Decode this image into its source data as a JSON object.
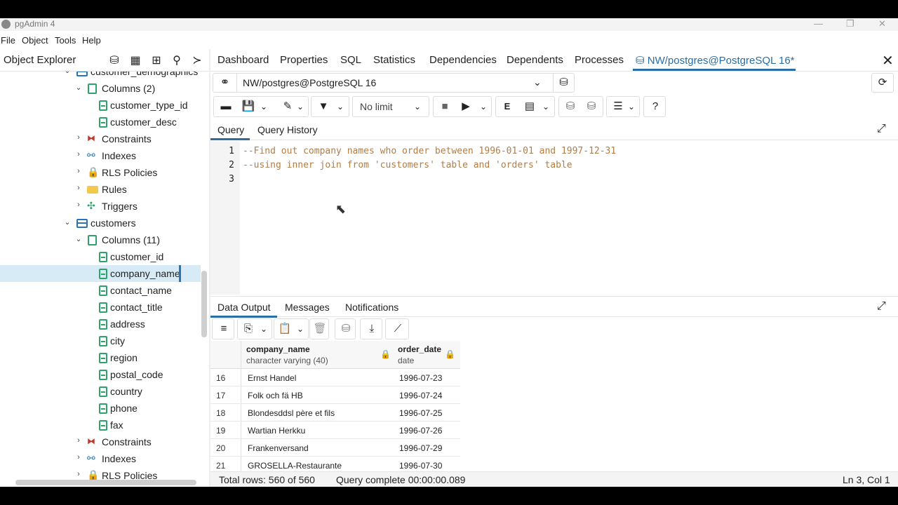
{
  "window": {
    "title": "pgAdmin 4",
    "minimize": "—",
    "maximize": "❐",
    "close": "✕"
  },
  "menu": [
    "File",
    "Object",
    "Tools",
    "Help"
  ],
  "object_explorer": {
    "title": "Object Explorer",
    "tree": [
      {
        "label": "customer_demographics",
        "twisty": "⌄",
        "icon": "table"
      },
      {
        "label": "Columns (2)",
        "twisty": "⌄",
        "icon": "columns"
      },
      {
        "label": "customer_type_id",
        "icon": "column"
      },
      {
        "label": "customer_desc",
        "icon": "column"
      },
      {
        "label": "Constraints",
        "twisty": "›",
        "icon": "constraints"
      },
      {
        "label": "Indexes",
        "twisty": "›",
        "icon": "indexes"
      },
      {
        "label": "RLS Policies",
        "twisty": "›",
        "icon": "rls"
      },
      {
        "label": "Rules",
        "twisty": "›",
        "icon": "rules"
      },
      {
        "label": "Triggers",
        "twisty": "›",
        "icon": "triggers"
      },
      {
        "label": "customers",
        "twisty": "⌄",
        "icon": "table"
      },
      {
        "label": "Columns (11)",
        "twisty": "⌄",
        "icon": "columns"
      },
      {
        "label": "customer_id",
        "icon": "column"
      },
      {
        "label": "company_name",
        "icon": "column",
        "selected": true
      },
      {
        "label": "contact_name",
        "icon": "column"
      },
      {
        "label": "contact_title",
        "icon": "column"
      },
      {
        "label": "address",
        "icon": "column"
      },
      {
        "label": "city",
        "icon": "column"
      },
      {
        "label": "region",
        "icon": "column"
      },
      {
        "label": "postal_code",
        "icon": "column"
      },
      {
        "label": "country",
        "icon": "column"
      },
      {
        "label": "phone",
        "icon": "column"
      },
      {
        "label": "fax",
        "icon": "column"
      },
      {
        "label": "Constraints",
        "twisty": "›",
        "icon": "constraints"
      },
      {
        "label": "Indexes",
        "twisty": "›",
        "icon": "indexes"
      },
      {
        "label": "RLS Policies",
        "twisty": "›",
        "icon": "rls"
      }
    ]
  },
  "tabs": {
    "items": [
      "Dashboard",
      "Properties",
      "SQL",
      "Statistics",
      "Dependencies",
      "Dependents",
      "Processes"
    ],
    "active": "NW/postgres@PostgreSQL 16*"
  },
  "connection": {
    "value": "NW/postgres@PostgreSQL 16"
  },
  "toolbar": {
    "limit": "No limit",
    "explain": "E"
  },
  "query_tabs": [
    "Query",
    "Query History"
  ],
  "editor": {
    "lines": [
      {
        "n": "1",
        "text": "--Find out company names who order between 1996-01-01 and 1997-12-31"
      },
      {
        "n": "2",
        "text": "--using inner join from 'customers' table and 'orders' table"
      },
      {
        "n": "3",
        "text": ""
      }
    ]
  },
  "output_tabs": [
    "Data Output",
    "Messages",
    "Notifications"
  ],
  "grid": {
    "columns": [
      {
        "name": "company_name",
        "type": "character varying (40)"
      },
      {
        "name": "order_date",
        "type": "date"
      }
    ],
    "rows": [
      {
        "n": "16",
        "company_name": "Ernst Handel",
        "order_date": "1996-07-23"
      },
      {
        "n": "17",
        "company_name": "Folk och fä HB",
        "order_date": "1996-07-24"
      },
      {
        "n": "18",
        "company_name": "Blondesddsl père et fils",
        "order_date": "1996-07-25"
      },
      {
        "n": "19",
        "company_name": "Wartian Herkku",
        "order_date": "1996-07-26"
      },
      {
        "n": "20",
        "company_name": "Frankenversand",
        "order_date": "1996-07-29"
      },
      {
        "n": "21",
        "company_name": "GROSELLA-Restaurante",
        "order_date": "1996-07-30"
      }
    ]
  },
  "status": {
    "total_rows": "Total rows: 560 of 560",
    "query_status": "Query complete 00:00:00.089",
    "position": "Ln 3, Col 1"
  },
  "colors": {
    "accent": "#2c6da3",
    "comment": "#b07d48",
    "selection": "#d7ebf7"
  }
}
